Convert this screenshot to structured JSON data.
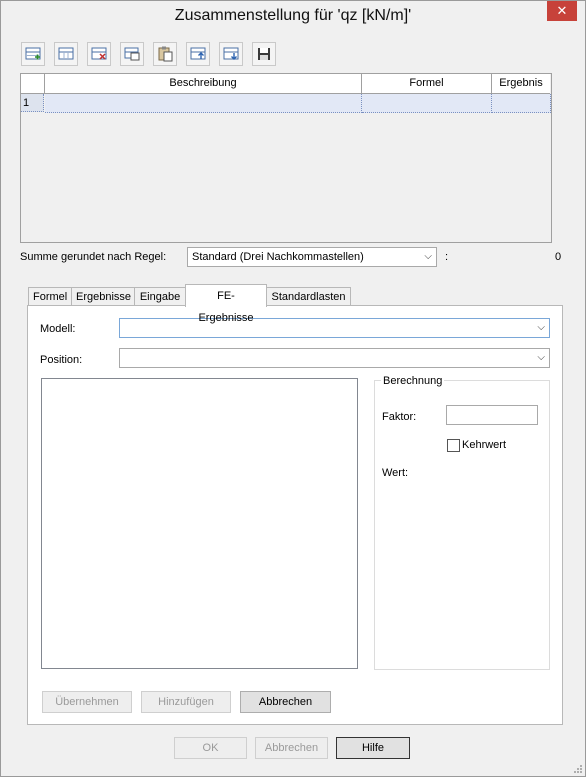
{
  "window": {
    "title": "Zusammenstellung für 'qz [kN/m]'",
    "close_glyph": "✕"
  },
  "toolbar": {
    "icons": [
      "insert-row-icon",
      "insert-column-icon",
      "delete-row-icon",
      "copy-row-icon",
      "paste-icon",
      "move-up-icon",
      "move-down-icon",
      "save-icon"
    ]
  },
  "grid": {
    "columns": [
      "Beschreibung",
      "Formel",
      "Ergebnis"
    ],
    "rows": [
      {
        "num": "1",
        "beschreibung": "",
        "formel": "",
        "ergebnis": ""
      }
    ]
  },
  "summary": {
    "label": "Summe gerundet nach Regel:",
    "rule_value": "Standard (Drei Nachkommastellen)",
    "colon": ":",
    "total": "0"
  },
  "tabs": [
    {
      "label": "Formel",
      "active": false
    },
    {
      "label": "Ergebnisse",
      "active": false
    },
    {
      "label": "Eingabe",
      "active": false
    },
    {
      "label": "FE-Ergebnisse",
      "active": true
    },
    {
      "label": "Standardlasten",
      "active": false
    }
  ],
  "fe": {
    "modell_label": "Modell:",
    "modell_value": "",
    "position_label": "Position:",
    "position_value": "",
    "berechnung_title": "Berechnung",
    "faktor_label": "Faktor:",
    "faktor_value": "",
    "kehrwert_label": "Kehrwert",
    "kehrwert_checked": false,
    "wert_label": "Wert:",
    "wert_value": ""
  },
  "panel_buttons": {
    "uebernehmen": "Übernehmen",
    "hinzufuegen": "Hinzufügen",
    "abbrechen": "Abbrechen"
  },
  "dialog_buttons": {
    "ok": "OK",
    "abbrechen": "Abbrechen",
    "hilfe": "Hilfe"
  },
  "colors": {
    "selected_row": "#e2e8f6",
    "close_red": "#c7423a",
    "focus_border": "#7aa7d8"
  }
}
